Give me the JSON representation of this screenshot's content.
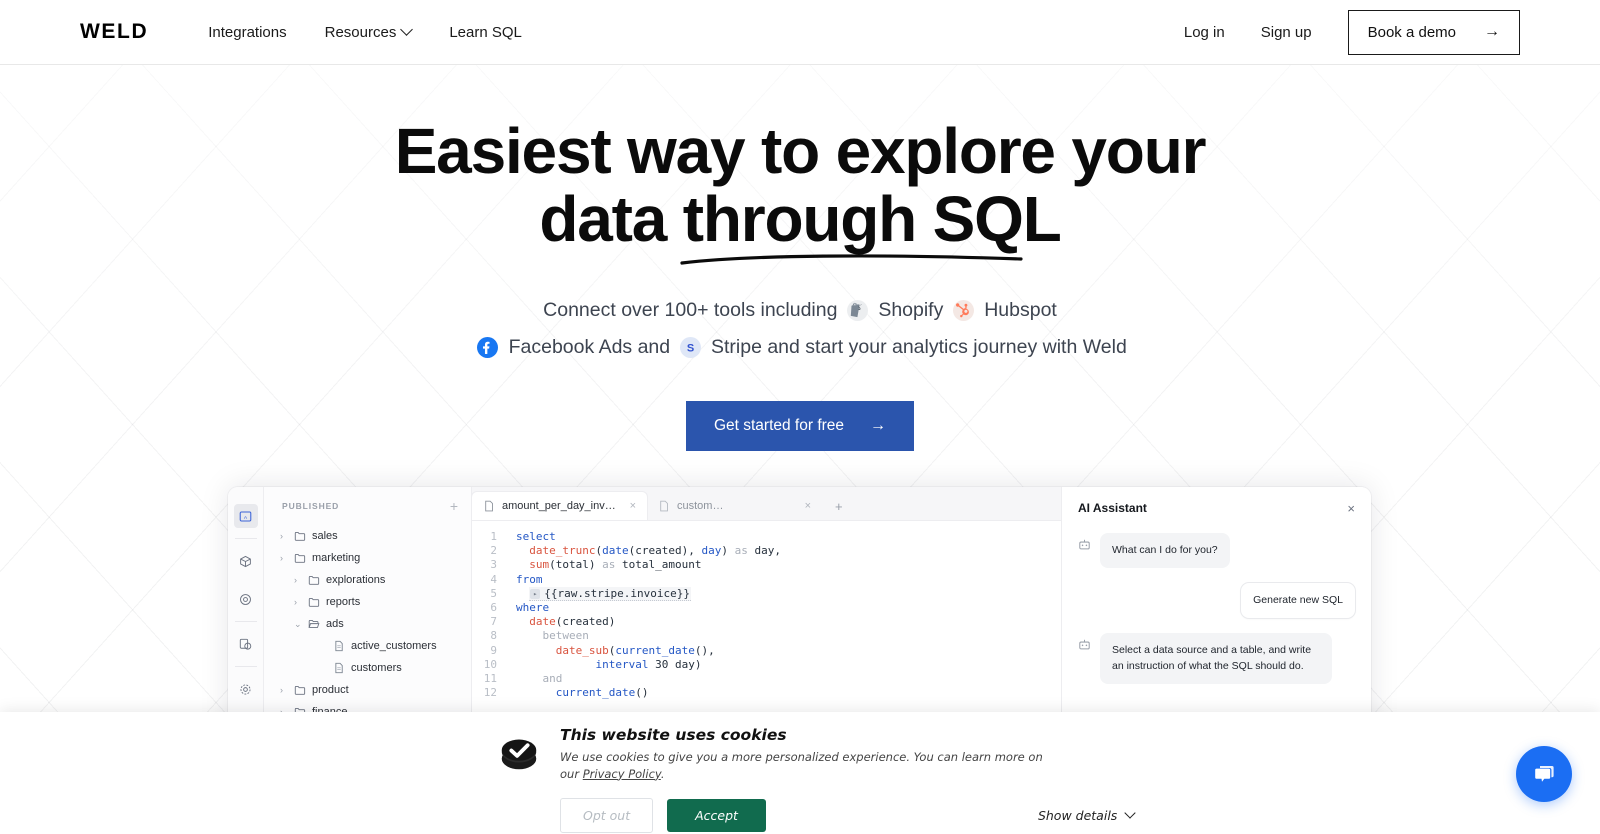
{
  "header": {
    "brand": "WELD",
    "nav": [
      {
        "label": "Integrations",
        "has_chevron": false
      },
      {
        "label": "Resources",
        "has_chevron": true
      },
      {
        "label": "Learn SQL",
        "has_chevron": false
      }
    ],
    "login_label": "Log in",
    "signup_label": "Sign up",
    "demo_label": "Book a demo",
    "demo_arrow": "→"
  },
  "hero": {
    "headline_line1": "Easiest way to explore your",
    "headline_line2_prefix": "data ",
    "headline_line2_underlined": "through SQL",
    "sub_part1": "Connect over 100+ tools including",
    "tool1": "Shopify",
    "tool2": "Hubspot",
    "tool3": "Facebook Ads and",
    "tool4": "Stripe and start your analytics journey with Weld",
    "icon1_name": "shopify-icon",
    "icon2_name": "hubspot-icon",
    "icon3_name": "facebook-icon",
    "icon4_name": "stripe-icon",
    "cta_label": "Get started for free",
    "cta_arrow": "→",
    "cta_color": "#2b55ad"
  },
  "app": {
    "rail": [
      {
        "name": "editor-icon",
        "active": true
      },
      {
        "name": "models-cube-icon",
        "active": false
      },
      {
        "name": "orchestration-icon",
        "active": false
      },
      {
        "name": "sources-copy-icon",
        "active": false
      },
      {
        "name": "settings-gear-icon",
        "active": false
      }
    ],
    "tree": {
      "title": "PUBLISHED",
      "add_label": "+",
      "nodes": [
        {
          "label": "sales",
          "depth": 1,
          "type": "folder",
          "expanded": false
        },
        {
          "label": "marketing",
          "depth": 1,
          "type": "folder",
          "expanded": false
        },
        {
          "label": "explorations",
          "depth": 2,
          "type": "folder",
          "expanded": false
        },
        {
          "label": "reports",
          "depth": 2,
          "type": "folder",
          "expanded": false
        },
        {
          "label": "ads",
          "depth": 2,
          "type": "folder-open",
          "expanded": true
        },
        {
          "label": "active_customers",
          "depth": 3,
          "type": "file"
        },
        {
          "label": "customers",
          "depth": 3,
          "type": "file"
        },
        {
          "label": "product",
          "depth": 1,
          "type": "folder",
          "expanded": false
        },
        {
          "label": "finance",
          "depth": 1,
          "type": "folder",
          "expanded": false
        }
      ]
    },
    "tabs": [
      {
        "label": "amount_per_day_invoic...",
        "active": true,
        "close": "×"
      },
      {
        "label": "customers",
        "active": false,
        "close": "×"
      }
    ],
    "tab_add": "+",
    "code_lines": [
      {
        "n": "1",
        "tokens": [
          {
            "t": "select",
            "c": "k"
          }
        ]
      },
      {
        "n": "2",
        "tokens": [
          {
            "t": "  ",
            "c": ""
          },
          {
            "t": "date_trunc",
            "c": "f"
          },
          {
            "t": "(",
            "c": ""
          },
          {
            "t": "date",
            "c": "k"
          },
          {
            "t": "(created), ",
            "c": ""
          },
          {
            "t": "day",
            "c": "k"
          },
          {
            "t": ") ",
            "c": ""
          },
          {
            "t": "as",
            "c": "dim"
          },
          {
            "t": " day,",
            "c": ""
          }
        ]
      },
      {
        "n": "3",
        "tokens": [
          {
            "t": "  ",
            "c": ""
          },
          {
            "t": "sum",
            "c": "f"
          },
          {
            "t": "(total) ",
            "c": ""
          },
          {
            "t": "as",
            "c": "dim"
          },
          {
            "t": " total_amount",
            "c": ""
          }
        ]
      },
      {
        "n": "4",
        "tokens": [
          {
            "t": "from",
            "c": "k"
          }
        ]
      },
      {
        "n": "5",
        "tokens": [
          {
            "t": "  ",
            "c": ""
          },
          {
            "t": "{{raw.stripe.invoice}}",
            "c": "ref"
          }
        ]
      },
      {
        "n": "6",
        "tokens": [
          {
            "t": "where",
            "c": "k"
          }
        ]
      },
      {
        "n": "7",
        "tokens": [
          {
            "t": "  ",
            "c": ""
          },
          {
            "t": "date",
            "c": "f"
          },
          {
            "t": "(created)",
            "c": ""
          }
        ]
      },
      {
        "n": "8",
        "tokens": [
          {
            "t": "    ",
            "c": ""
          },
          {
            "t": "between",
            "c": "dim"
          }
        ]
      },
      {
        "n": "9",
        "tokens": [
          {
            "t": "      ",
            "c": ""
          },
          {
            "t": "date_sub",
            "c": "f"
          },
          {
            "t": "(",
            "c": ""
          },
          {
            "t": "current_date",
            "c": "k"
          },
          {
            "t": "(),",
            "c": ""
          }
        ]
      },
      {
        "n": "10",
        "tokens": [
          {
            "t": "            ",
            "c": ""
          },
          {
            "t": "interval",
            "c": "k"
          },
          {
            "t": " 30 day)",
            "c": ""
          }
        ]
      },
      {
        "n": "11",
        "tokens": [
          {
            "t": "    ",
            "c": ""
          },
          {
            "t": "and",
            "c": "dim"
          }
        ]
      },
      {
        "n": "12",
        "tokens": [
          {
            "t": "      ",
            "c": ""
          },
          {
            "t": "current_date",
            "c": "k"
          },
          {
            "t": "()",
            "c": ""
          }
        ]
      }
    ],
    "ai": {
      "title": "AI Assistant",
      "close": "×",
      "messages": [
        {
          "from": "bot",
          "text": "What can I do for you?"
        },
        {
          "from": "user",
          "text": "Generate new SQL"
        },
        {
          "from": "bot",
          "text": "Select a data source and a table, and write an instruction of what the SQL should do."
        }
      ]
    }
  },
  "cookie": {
    "icon_name": "cookiebot-check-icon",
    "title": "This website uses cookies",
    "text_before_link": "We use cookies to give you a more personalized experience. You can learn more on our ",
    "link": "Privacy Policy",
    "text_after_link": ".",
    "optout_label": "Opt out",
    "accept_label": "Accept",
    "accept_color": "#116b4e",
    "details_label": "Show details"
  },
  "chat": {
    "icon_name": "chat-bubble-icon",
    "color": "#1b6ef3"
  }
}
